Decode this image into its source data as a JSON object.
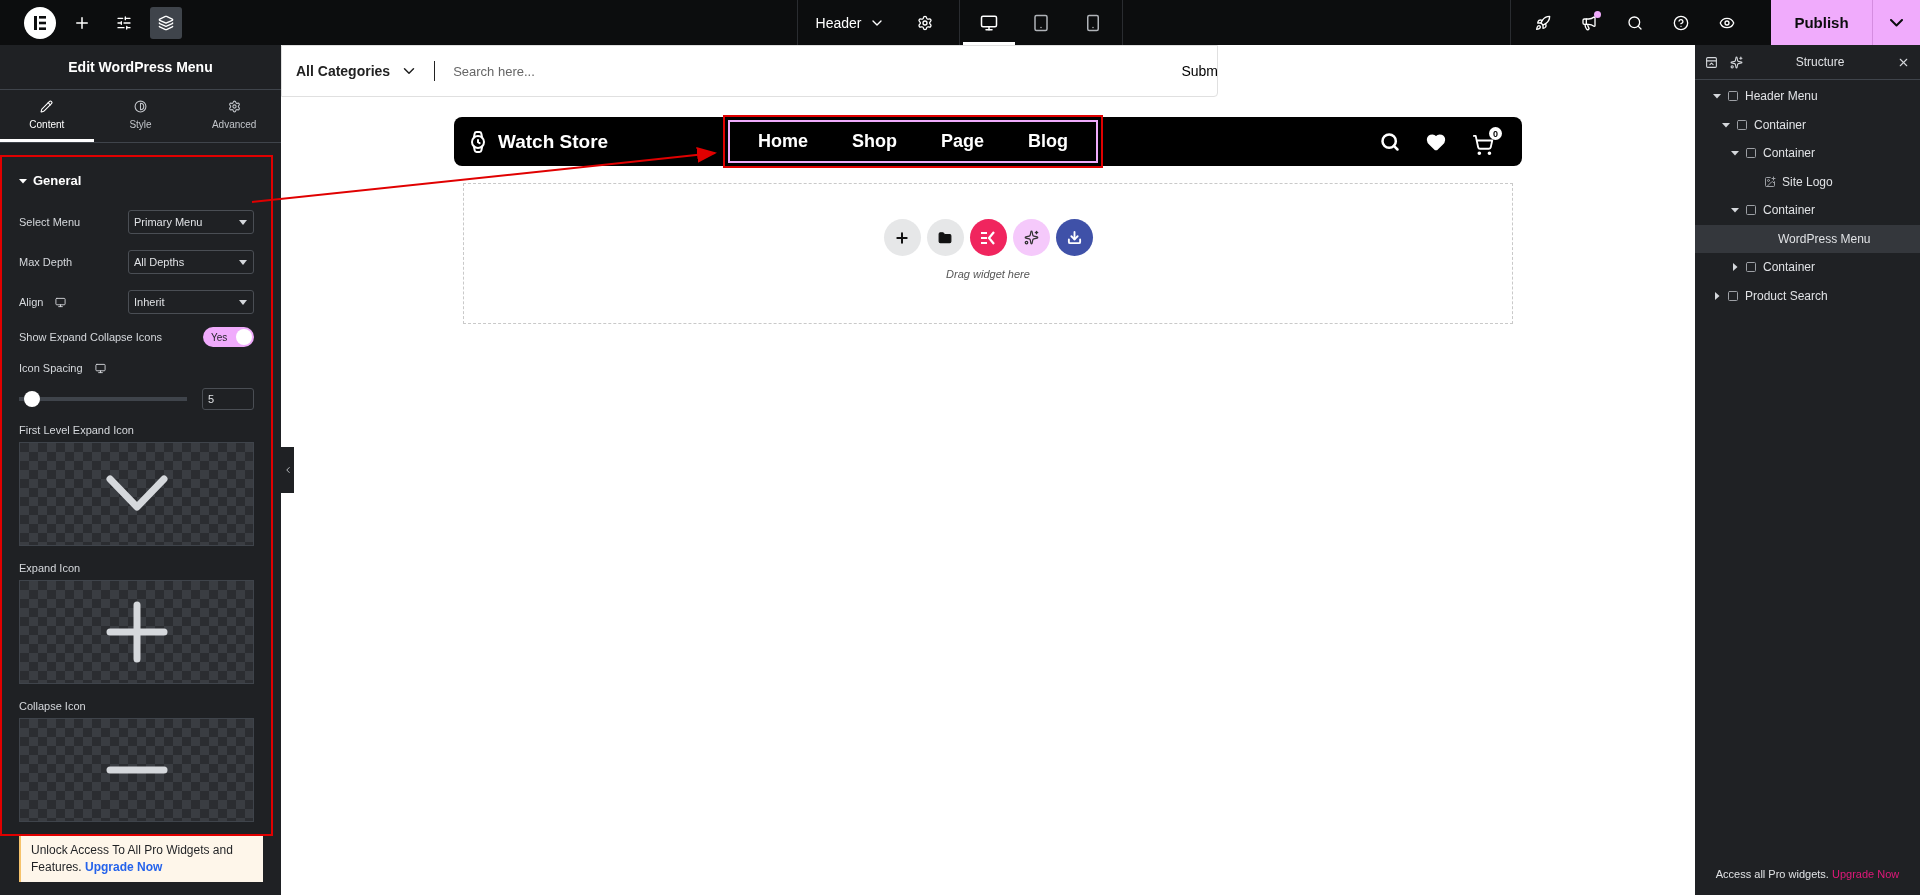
{
  "top_bar": {
    "document": "Header",
    "devices": [
      {
        "kind": "desktop",
        "selected": true
      },
      {
        "kind": "tablet",
        "selected": false
      },
      {
        "kind": "mobile",
        "selected": false
      }
    ],
    "notification": true,
    "publish": "Publish"
  },
  "left_panel": {
    "title": "Edit WordPress Menu",
    "tabs": [
      {
        "label": "Content",
        "kind": "pencil",
        "selected": true
      },
      {
        "label": "Style",
        "kind": "contrast",
        "selected": false
      },
      {
        "label": "Advanced",
        "kind": "gear",
        "selected": false
      }
    ],
    "section": {
      "title": "General",
      "expanded": true,
      "selects": [
        {
          "label": "Select Menu",
          "value": "Primary Menu",
          "responsive": false
        },
        {
          "label": "Max Depth",
          "value": "All Depths",
          "responsive": false
        },
        {
          "label": "Align",
          "value": "Inherit",
          "responsive": true
        }
      ],
      "toggle": {
        "label": "Show Expand Collapse Icons",
        "value": "Yes",
        "on": true
      },
      "slider": {
        "label": "Icon Spacing",
        "responsive": true,
        "level": 0.03,
        "value": "5"
      },
      "icon_pickers": [
        {
          "label": "First Level Expand Icon",
          "kind": "chevron"
        },
        {
          "label": "Expand Icon",
          "kind": "plus"
        },
        {
          "label": "Collapse Icon",
          "kind": "minus"
        }
      ]
    },
    "promo": {
      "text": "Unlock Access To All Pro Widgets and Features.",
      "link": "Upgrade Now"
    }
  },
  "canvas": {
    "search": {
      "category": "All Categories",
      "placeholder": "Search here...",
      "button": "Subm"
    },
    "nav": {
      "brand": "Watch Store",
      "menu": [
        "Home",
        "Shop",
        "Page",
        "Blog"
      ],
      "cart_count": "0"
    },
    "drop_zone": {
      "hint": "Drag widget here"
    }
  },
  "structure": {
    "title": "Structure",
    "tree": [
      {
        "label": "Header Menu",
        "kind": "container",
        "expanded": true,
        "selected": false,
        "children": [
          {
            "label": "Container",
            "kind": "container",
            "expanded": true,
            "selected": false,
            "children": [
              {
                "label": "Container",
                "kind": "container",
                "expanded": true,
                "selected": false,
                "children": [
                  {
                    "label": "Site Logo",
                    "kind": "image",
                    "selected": false
                  }
                ]
              },
              {
                "label": "Container",
                "kind": "container",
                "expanded": true,
                "selected": false,
                "children": [
                  {
                    "label": "WordPress Menu",
                    "kind": "widget",
                    "selected": true
                  }
                ]
              },
              {
                "label": "Container",
                "kind": "container",
                "expanded": false,
                "selected": false
              }
            ]
          }
        ]
      },
      {
        "label": "Product Search",
        "kind": "container",
        "expanded": false,
        "selected": false
      }
    ],
    "footer": {
      "text": "Access all Pro widgets.",
      "link": "Upgrade Now"
    }
  }
}
